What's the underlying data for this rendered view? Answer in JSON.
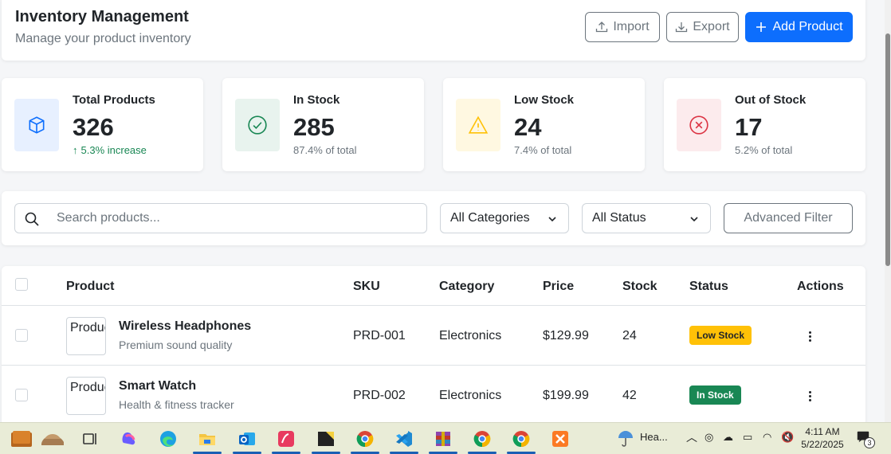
{
  "header": {
    "title": "Inventory Management",
    "subtitle": "Manage your product inventory",
    "import_label": "Import",
    "export_label": "Export",
    "add_label": "Add Product"
  },
  "stats": [
    {
      "label": "Total Products",
      "value": "326",
      "note": "5.3% increase",
      "icon": "box-icon",
      "color": "#0d6efd"
    },
    {
      "label": "In Stock",
      "value": "285",
      "note": "87.4% of total",
      "icon": "check-circle-icon",
      "color": "#198754"
    },
    {
      "label": "Low Stock",
      "value": "24",
      "note": "7.4% of total",
      "icon": "warning-icon",
      "color": "#ffc107"
    },
    {
      "label": "Out of Stock",
      "value": "17",
      "note": "5.2% of total",
      "icon": "x-circle-icon",
      "color": "#dc3545"
    }
  ],
  "filters": {
    "search_placeholder": "Search products...",
    "category": "All Categories",
    "status": "All Status",
    "advanced_label": "Advanced Filter"
  },
  "table": {
    "columns": [
      "Product",
      "SKU",
      "Category",
      "Price",
      "Stock",
      "Status",
      "Actions"
    ],
    "rows": [
      {
        "img_alt": "Product",
        "name": "Wireless Headphones",
        "desc": "Premium sound quality",
        "sku": "PRD-001",
        "category": "Electronics",
        "price": "$129.99",
        "stock": "24",
        "status": "Low Stock"
      },
      {
        "img_alt": "Product",
        "name": "Smart Watch",
        "desc": "Health & fitness tracker",
        "sku": "PRD-002",
        "category": "Electronics",
        "price": "$199.99",
        "stock": "42",
        "status": "In Stock"
      }
    ]
  },
  "taskbar": {
    "weather": "Hea...",
    "time": "4:11 AM",
    "date": "5/22/2025",
    "notification_count": "3"
  },
  "colors": {
    "primary": "#0d6efd",
    "success": "#198754",
    "warning": "#ffc107",
    "danger": "#dc3545"
  }
}
